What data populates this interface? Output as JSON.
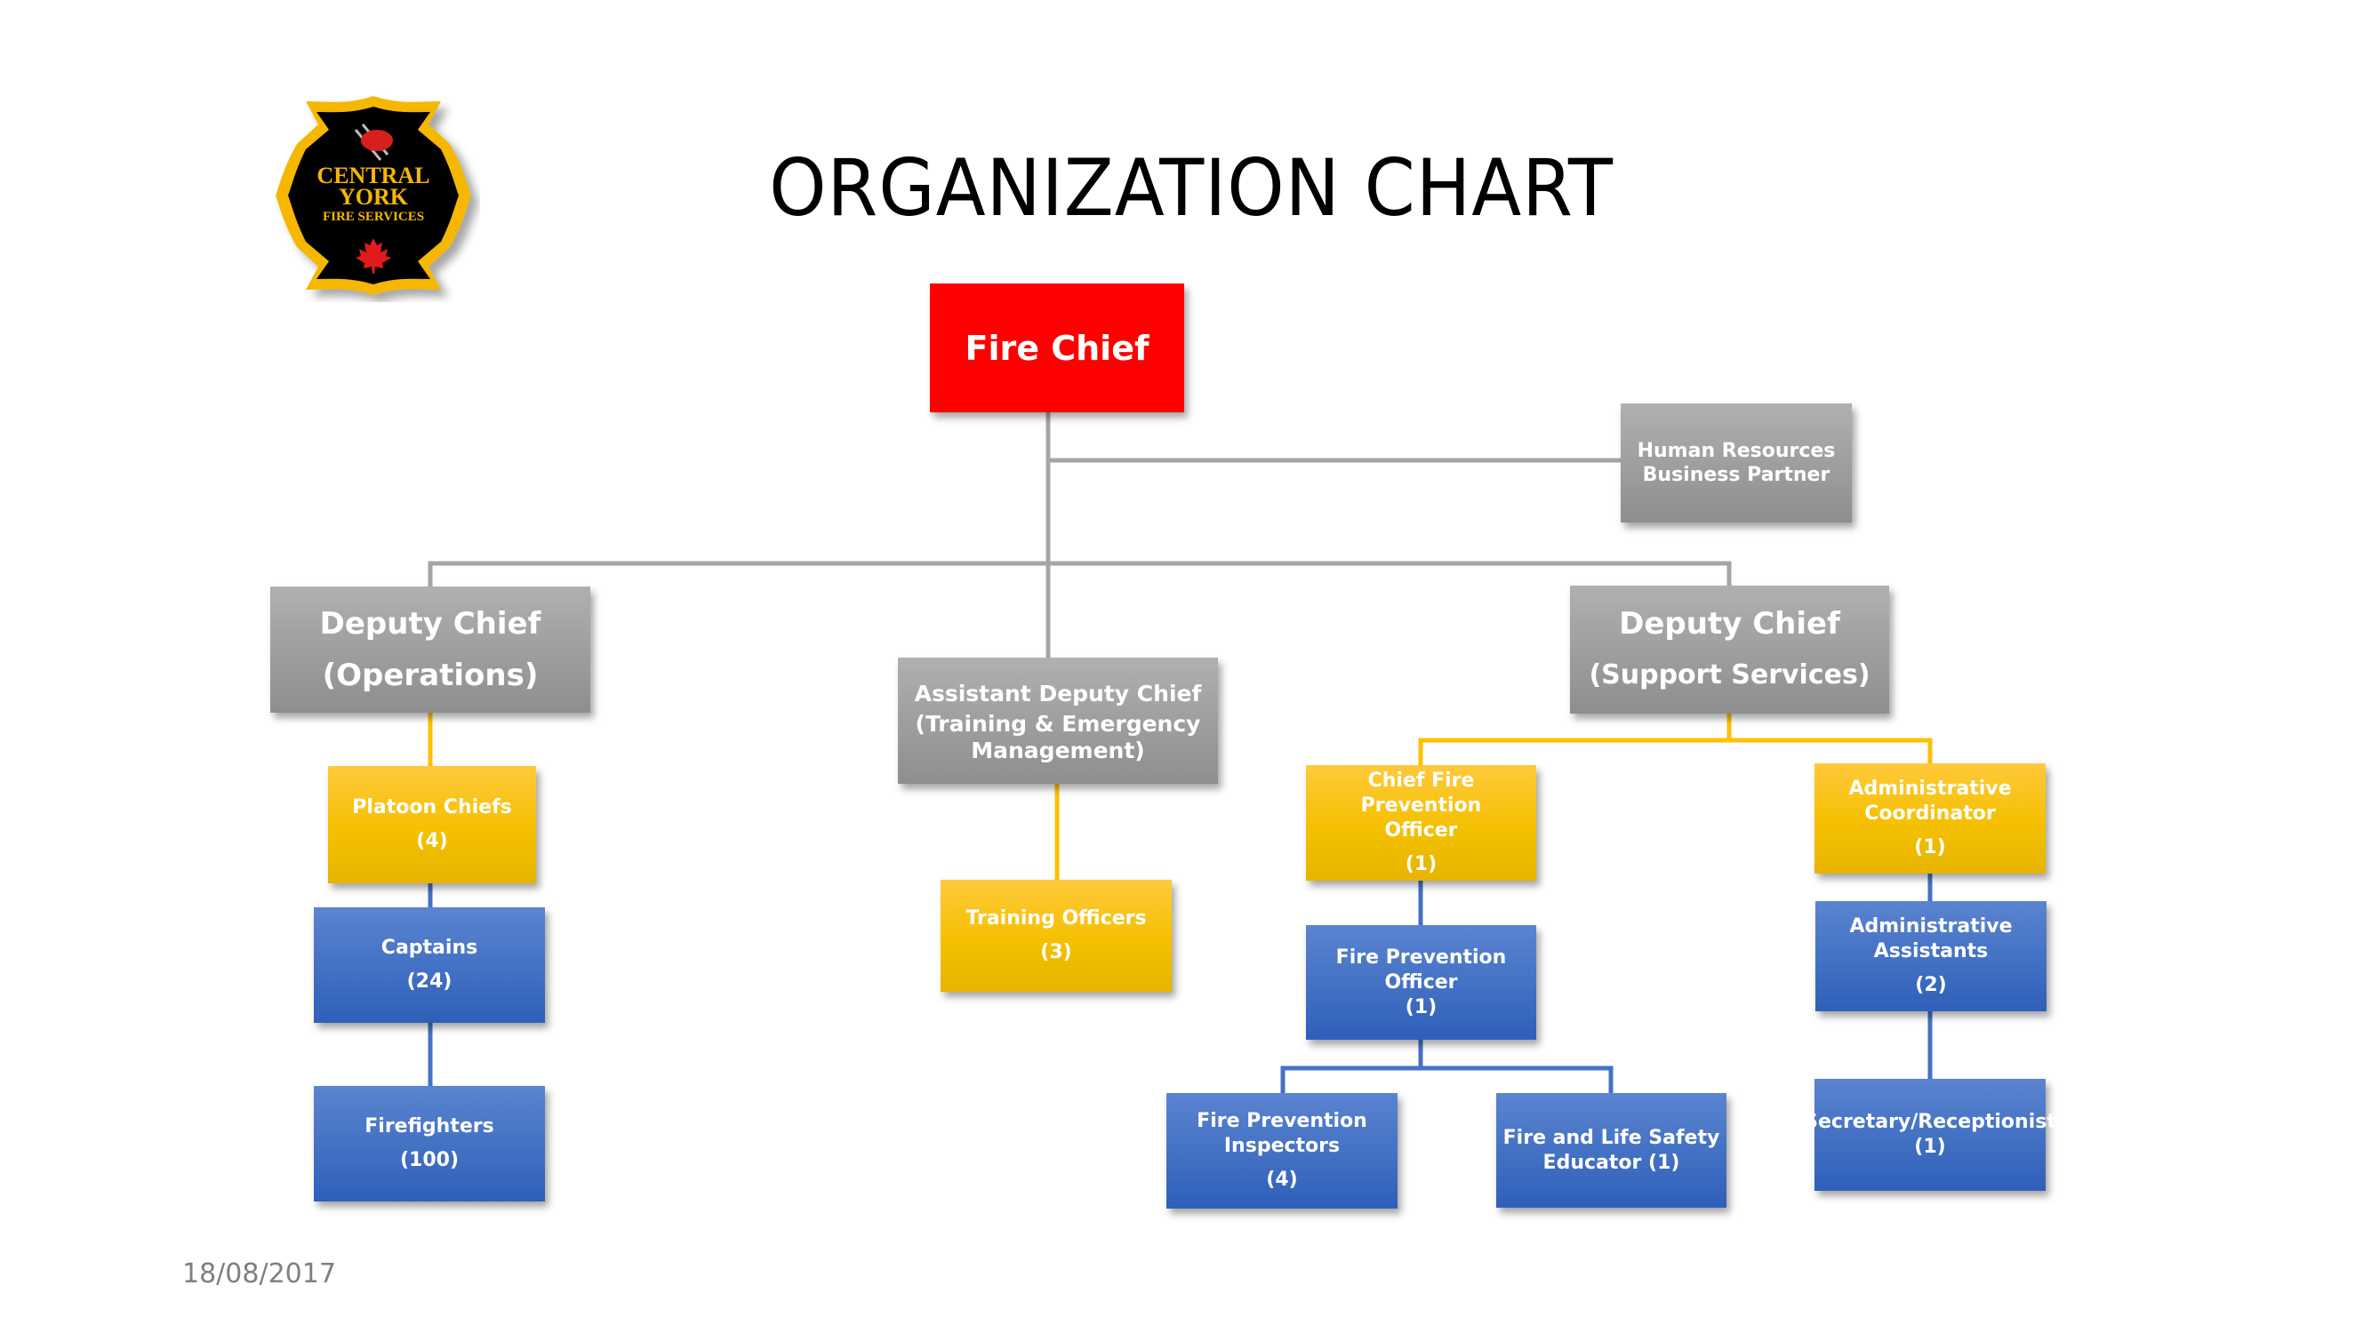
{
  "title": "ORGANIZATION CHART",
  "date": "18/08/2017",
  "logo": {
    "line1": "CENTRAL",
    "line2": "YORK",
    "line3": "FIRE SERVICES",
    "icon": "maltese-cross-badge-icon"
  },
  "colors": {
    "executive": "#FF0000",
    "management": "#A5A5A5",
    "supervisory": "#FFC000",
    "staff": "#4472C4",
    "connector_grey": "#A5A5A5",
    "connector_yellow": "#FFC000",
    "connector_blue": "#4472C4"
  },
  "nodes": {
    "fire_chief": {
      "lines": [
        "Fire Chief"
      ]
    },
    "hr": {
      "lines": [
        "Human Resources",
        "Business Partner"
      ]
    },
    "deputy_ops": {
      "lines": [
        "Deputy Chief",
        "(Operations)"
      ]
    },
    "asst_deputy": {
      "lines": [
        "Assistant Deputy Chief",
        "(Training  &  Emergency",
        "Management)"
      ]
    },
    "deputy_support": {
      "lines": [
        "Deputy Chief",
        "(Support Services)"
      ]
    },
    "platoon_chiefs": {
      "lines": [
        "Platoon Chiefs",
        "(4)"
      ]
    },
    "captains": {
      "lines": [
        "Captains",
        "(24)"
      ]
    },
    "firefighters": {
      "lines": [
        "Firefighters",
        "(100)"
      ]
    },
    "training_officers": {
      "lines": [
        "Training Officers",
        "(3)"
      ]
    },
    "chief_fpo": {
      "lines": [
        "Chief Fire Prevention",
        "Officer",
        "(1)"
      ]
    },
    "fpo": {
      "lines": [
        "Fire Prevention Officer",
        "(1)"
      ]
    },
    "inspectors": {
      "lines": [
        "Fire Prevention",
        "Inspectors",
        "(4)"
      ]
    },
    "educator": {
      "lines": [
        "Fire and Life Safety",
        "Educator (1)"
      ]
    },
    "admin_coord": {
      "lines": [
        "Administrative",
        "Coordinator",
        "(1)"
      ]
    },
    "admin_assist": {
      "lines": [
        "Administrative",
        "Assistants",
        "(2)"
      ]
    },
    "secretary": {
      "lines": [
        "Secretary/Receptionist",
        "(1)"
      ]
    }
  }
}
